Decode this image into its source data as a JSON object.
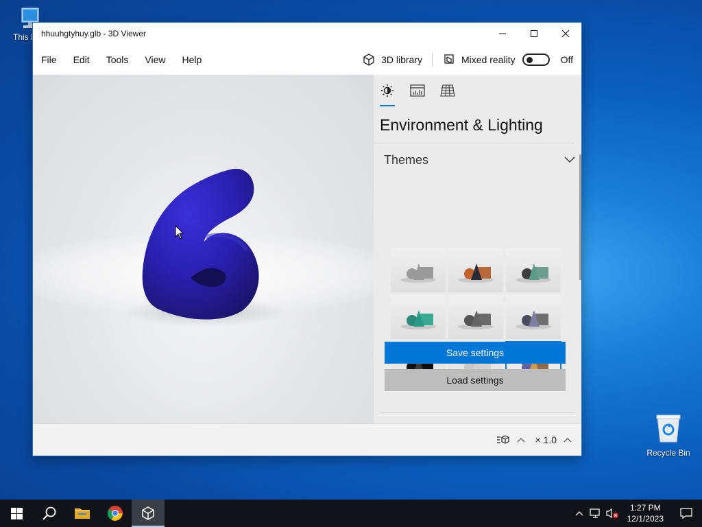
{
  "desktop": {
    "this_pc_label": "This PC",
    "recycle_bin_label": "Recycle Bin"
  },
  "window": {
    "title": "hhuuhgtyhuy.glb - 3D Viewer"
  },
  "menu": {
    "items": [
      "File",
      "Edit",
      "Tools",
      "View",
      "Help"
    ],
    "library_label": "3D library",
    "mixed_reality_label": "Mixed reality",
    "toggle_state": "Off"
  },
  "panel": {
    "tabs": [
      {
        "icon": "sun-icon",
        "active": true
      },
      {
        "icon": "stats-icon",
        "active": false
      },
      {
        "icon": "grid-icon",
        "active": false
      }
    ],
    "title": "Environment & Lighting",
    "section_title": "Themes",
    "themes": [
      {
        "sphere": "#9a9a9a",
        "cone": "#9a9a9a",
        "box": "#9a9a9a",
        "selected": false
      },
      {
        "sphere": "#c4622d",
        "cone": "#2b2b38",
        "box": "#b8683a",
        "selected": false
      },
      {
        "sphere": "#3f3f3f",
        "cone": "#5d9a8a",
        "box": "#6e9e90",
        "selected": false
      },
      {
        "sphere": "#2a8a78",
        "cone": "#2a9a86",
        "box": "#3aaa94",
        "selected": false
      },
      {
        "sphere": "#555555",
        "cone": "#666666",
        "box": "#6a6a6a",
        "selected": false
      },
      {
        "sphere": "#4d4d60",
        "cone": "#7e7ea0",
        "box": "#707070",
        "selected": false
      },
      {
        "sphere": "#111111",
        "cone": "#3a3a3a",
        "box": "#0d0d0d",
        "selected": false
      },
      {
        "sphere": "#c8c8c8",
        "cone": "#cfcfcf",
        "box": "#d4d4d4",
        "selected": false
      },
      {
        "sphere": "#6060a0",
        "cone": "#c99a50",
        "box": "#8c6a4a",
        "selected": true
      }
    ],
    "save_label": "Save settings",
    "load_label": "Load settings"
  },
  "status": {
    "speed": "× 1.0"
  },
  "taskbar": {
    "time": "1:27 PM",
    "date": "12/1/2023"
  },
  "colors": {
    "accent": "#0078d7",
    "model": "#2a1fb0"
  }
}
